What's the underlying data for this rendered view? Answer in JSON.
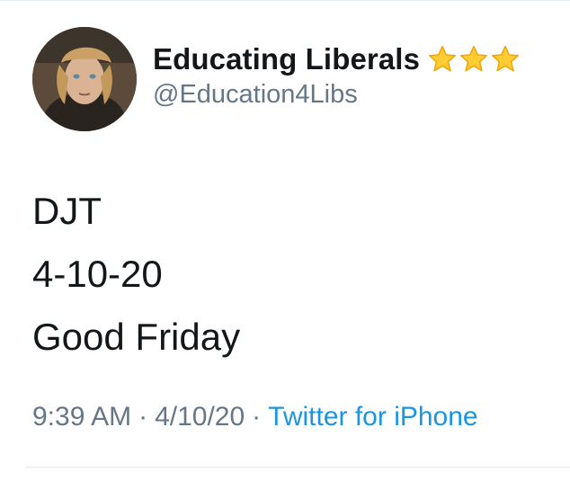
{
  "user": {
    "display_name": "Educating Liberals",
    "handle": "@Education4Libs",
    "badge_icons": [
      "star-icon",
      "star-icon",
      "star-icon"
    ]
  },
  "tweet": {
    "lines": [
      "DJT",
      "4-10-20",
      "Good Friday"
    ]
  },
  "meta": {
    "time": "9:39 AM",
    "separator": "·",
    "date": "4/10/20",
    "source": "Twitter for iPhone"
  },
  "colors": {
    "text": "#14171a",
    "secondary": "#657786",
    "link": "#1b95e0",
    "star": "#ffcc33"
  }
}
